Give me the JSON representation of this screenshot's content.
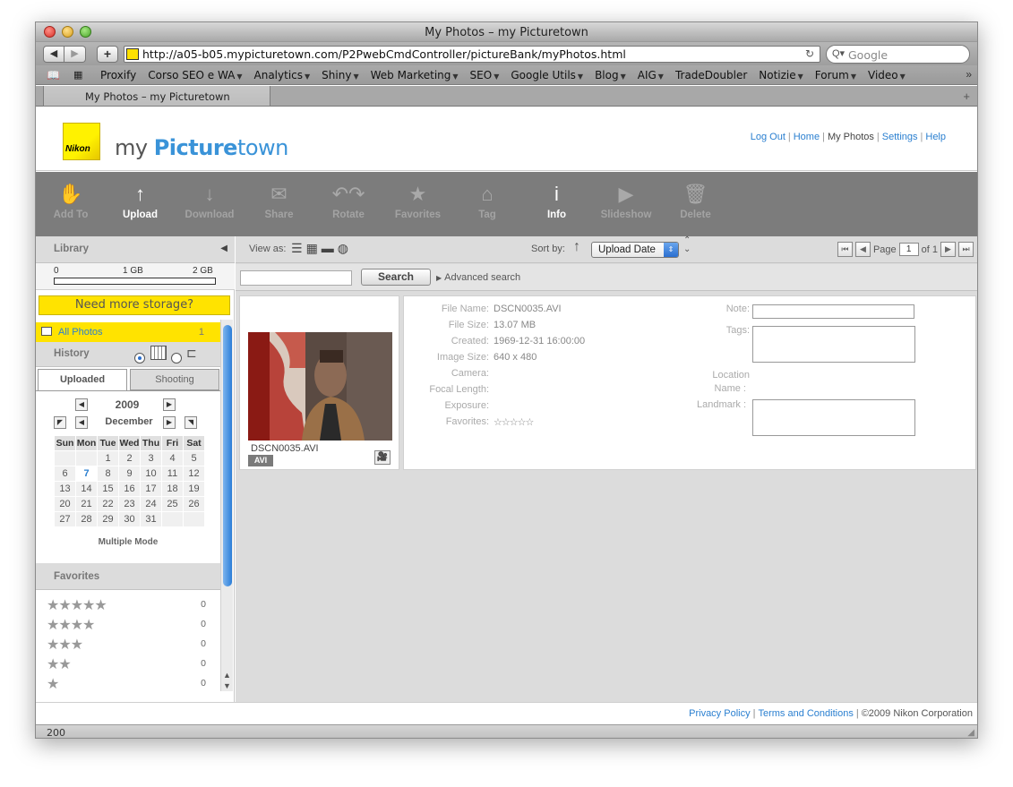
{
  "window": {
    "title": "My Photos – my Picturetown"
  },
  "browser": {
    "url": "http://a05-b05.mypicturetown.com/P2PwebCmdController/pictureBank/myPhotos.html",
    "search_placeholder": "Google",
    "bookmarks": [
      {
        "label": "Proxify",
        "menu": false
      },
      {
        "label": "Corso SEO e WA",
        "menu": true
      },
      {
        "label": "Analytics",
        "menu": true
      },
      {
        "label": "Shiny",
        "menu": true
      },
      {
        "label": "Web Marketing",
        "menu": true
      },
      {
        "label": "SEO",
        "menu": true
      },
      {
        "label": "Google Utils",
        "menu": true
      },
      {
        "label": "Blog",
        "menu": true
      },
      {
        "label": "AIG",
        "menu": true
      },
      {
        "label": "TradeDoubler",
        "menu": false
      },
      {
        "label": "Notizie",
        "menu": true
      },
      {
        "label": "Forum",
        "menu": true
      },
      {
        "label": "Video",
        "menu": true
      }
    ],
    "tab_label": "My Photos – my Picturetown",
    "status": "200"
  },
  "header": {
    "logo_text": "Nikon",
    "brand_my": "my ",
    "brand_picture": "Picture",
    "brand_town": "town",
    "links": {
      "logout": "Log Out",
      "home": "Home",
      "myphotos": "My Photos",
      "settings": "Settings",
      "help": "Help"
    }
  },
  "actions": [
    {
      "label": "Add To",
      "icon": "hand-icon",
      "glyph": "✋",
      "active": false
    },
    {
      "label": "Upload",
      "icon": "upload-arrow-icon",
      "glyph": "↑",
      "active": true
    },
    {
      "label": "Download",
      "icon": "download-arrow-icon",
      "glyph": "↓",
      "active": false
    },
    {
      "label": "Share",
      "icon": "envelope-icon",
      "glyph": "✉",
      "active": false
    },
    {
      "label": "Rotate",
      "icon": "rotate-icon",
      "glyph": "↶↷",
      "active": false
    },
    {
      "label": "Favorites",
      "icon": "star-icon",
      "glyph": "★",
      "active": false
    },
    {
      "label": "Tag",
      "icon": "tag-icon",
      "glyph": "⌂",
      "active": false
    },
    {
      "label": "Info",
      "icon": "info-icon",
      "glyph": "i",
      "active": true
    },
    {
      "label": "Slideshow",
      "icon": "play-icon",
      "glyph": "▶",
      "active": false
    },
    {
      "label": "Delete",
      "icon": "trash-icon",
      "glyph": "🗑",
      "active": false
    }
  ],
  "sidebar": {
    "library_title": "Library",
    "storage": {
      "min": "0",
      "mid": "1 GB",
      "max": "2 GB",
      "used_fraction": 0.0
    },
    "need_more": "Need more storage?",
    "all_photos": {
      "label": "All Photos",
      "count": "1"
    },
    "history_title": "History",
    "tabs": {
      "uploaded": "Uploaded",
      "shooting": "Shooting"
    },
    "calendar": {
      "year": "2009",
      "month": "December",
      "weekdays": [
        "Sun",
        "Mon",
        "Tue",
        "Wed",
        "Thu",
        "Fri",
        "Sat"
      ],
      "weeks": [
        [
          "",
          "",
          "1",
          "2",
          "3",
          "4",
          "5"
        ],
        [
          "6",
          "7",
          "8",
          "9",
          "10",
          "11",
          "12"
        ],
        [
          "13",
          "14",
          "15",
          "16",
          "17",
          "18",
          "19"
        ],
        [
          "20",
          "21",
          "22",
          "23",
          "24",
          "25",
          "26"
        ],
        [
          "27",
          "28",
          "29",
          "30",
          "31",
          "",
          ""
        ]
      ],
      "highlight": "7",
      "multiple_mode": "Multiple Mode"
    },
    "favorites_title": "Favorites",
    "favorites": [
      {
        "stars": 5,
        "count": "0"
      },
      {
        "stars": 4,
        "count": "0"
      },
      {
        "stars": 3,
        "count": "0"
      },
      {
        "stars": 2,
        "count": "0"
      },
      {
        "stars": 1,
        "count": "0"
      }
    ]
  },
  "main": {
    "view_as": "View as:",
    "sort_by": "Sort by:",
    "sort_value": "Upload Date",
    "page_label": "Page",
    "page_value": "1",
    "page_of": "of 1",
    "search_button": "Search",
    "advanced_search": "Advanced search",
    "thumb": {
      "name": "DSCN0035.AVI",
      "badge": "AVI"
    },
    "info": [
      {
        "key": "File Name:",
        "value": "DSCN0035.AVI"
      },
      {
        "key": "File Size:",
        "value": "13.07 MB"
      },
      {
        "key": "Created:",
        "value": "1969-12-31 16:00:00"
      },
      {
        "key": "Image Size:",
        "value": "640 x 480"
      },
      {
        "key": "Camera:",
        "value": ""
      },
      {
        "key": "Focal Length:",
        "value": ""
      },
      {
        "key": "Exposure:",
        "value": ""
      },
      {
        "key": "Favorites:",
        "value": "☆☆☆☆☆"
      }
    ],
    "note_label": "Note:",
    "tags_label": "Tags:",
    "location_label_1": "Location",
    "location_label_2": "Name :",
    "landmark_label": "Landmark :"
  },
  "footer": {
    "privacy": "Privacy Policy",
    "terms": "Terms and Conditions",
    "copyright": "©2009 Nikon Corporation"
  }
}
